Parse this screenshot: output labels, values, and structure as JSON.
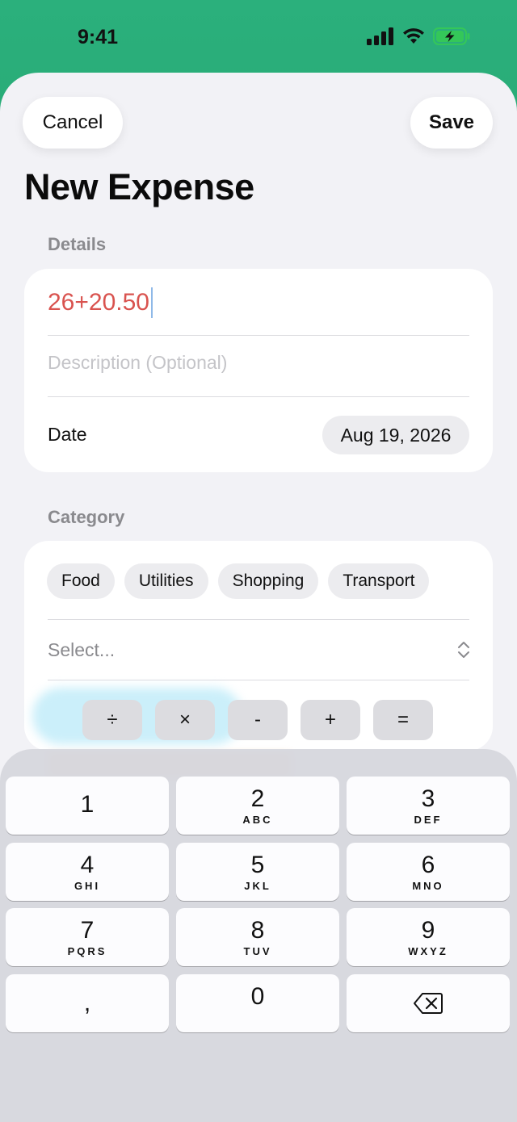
{
  "status": {
    "time": "9:41"
  },
  "header": {
    "cancel_label": "Cancel",
    "save_label": "Save",
    "title": "New Expense"
  },
  "details": {
    "section_label": "Details",
    "amount_value": "26+20.50",
    "description_placeholder": "Description (Optional)",
    "date_label": "Date",
    "date_value": "Aug 19, 2026"
  },
  "category": {
    "section_label": "Category",
    "chips": [
      "Food",
      "Utilities",
      "Shopping",
      "Transport"
    ],
    "select_placeholder": "Select..."
  },
  "operators": [
    "÷",
    "×",
    "-",
    "+",
    "="
  ],
  "keypad": {
    "keys": [
      {
        "num": "1",
        "letters": ""
      },
      {
        "num": "2",
        "letters": "ABC"
      },
      {
        "num": "3",
        "letters": "DEF"
      },
      {
        "num": "4",
        "letters": "GHI"
      },
      {
        "num": "5",
        "letters": "JKL"
      },
      {
        "num": "6",
        "letters": "MNO"
      },
      {
        "num": "7",
        "letters": "PQRS"
      },
      {
        "num": "8",
        "letters": "TUV"
      },
      {
        "num": "9",
        "letters": "WXYZ"
      },
      {
        "num": ",",
        "letters": ""
      },
      {
        "num": "0",
        "letters": ""
      }
    ]
  },
  "colors": {
    "accent_green": "#1f9e63",
    "amount_red": "#d9534f",
    "battery_green": "#34c759"
  },
  "icons": {
    "signal": "cellular-signal-icon",
    "wifi": "wifi-icon",
    "battery": "battery-charging-icon",
    "chevron": "chevron-up-down-icon",
    "backspace": "backspace-icon"
  }
}
